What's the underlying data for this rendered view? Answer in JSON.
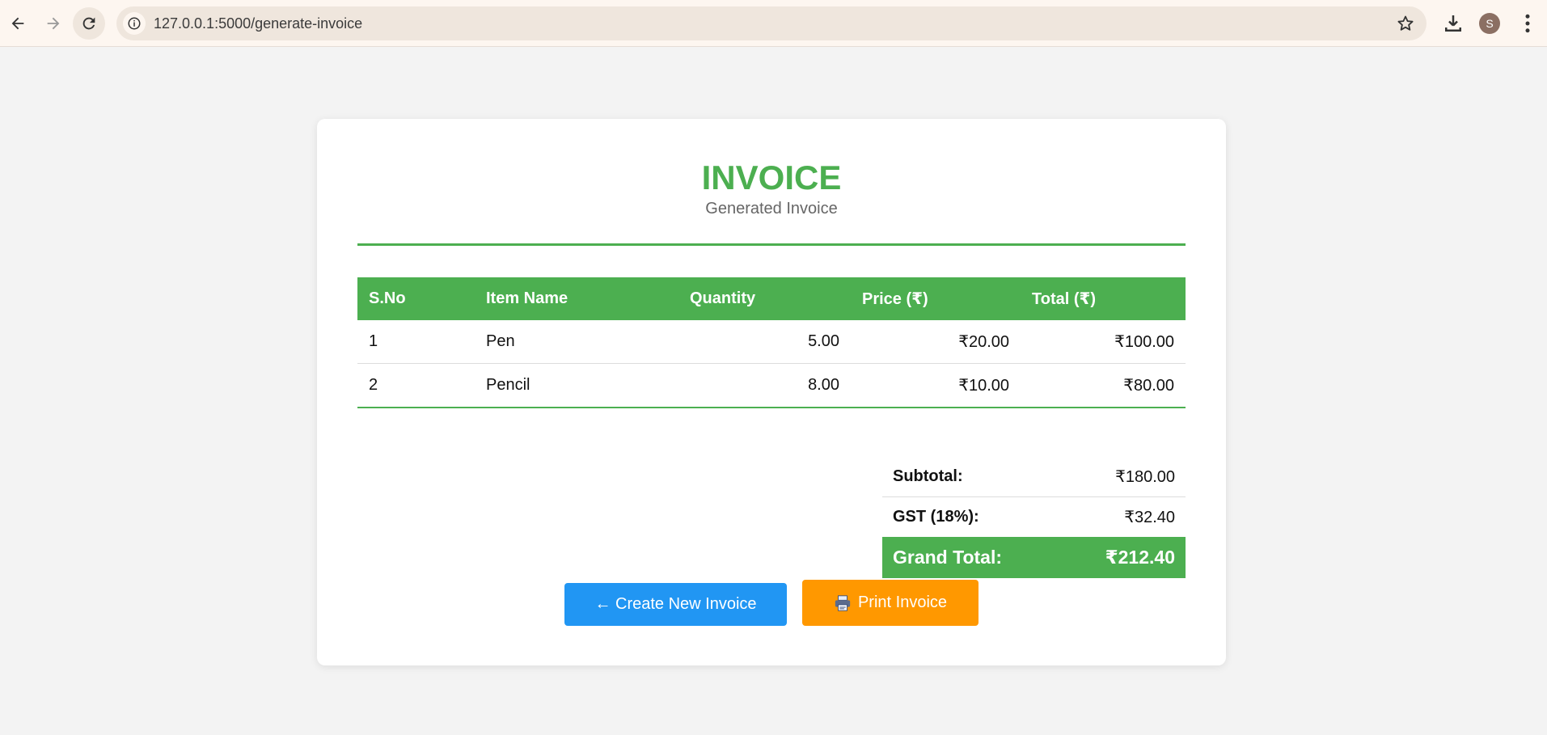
{
  "browser": {
    "url": "127.0.0.1:5000/generate-invoice",
    "profile_initial": "S"
  },
  "invoice": {
    "title": "INVOICE",
    "subtitle": "Generated Invoice",
    "columns": [
      "S.No",
      "Item Name",
      "Quantity",
      "Price (₹)",
      "Total (₹)"
    ],
    "rows": [
      {
        "sno": "1",
        "item": "Pen",
        "quantity": "5.00",
        "price": "₹20.00",
        "total": "₹100.00"
      },
      {
        "sno": "2",
        "item": "Pencil",
        "quantity": "8.00",
        "price": "₹10.00",
        "total": "₹80.00"
      }
    ],
    "summary": {
      "subtotal_label": "Subtotal:",
      "subtotal_value": "₹180.00",
      "gst_label": "GST (18%):",
      "gst_value": "₹32.40",
      "grand_label": "Grand Total:",
      "grand_value": "₹212.40"
    },
    "buttons": {
      "create_new": "← Create New Invoice",
      "print": "Print Invoice"
    }
  },
  "colors": {
    "accent_green": "#4caf50",
    "button_blue": "#2196f3",
    "button_orange": "#ff9800"
  }
}
